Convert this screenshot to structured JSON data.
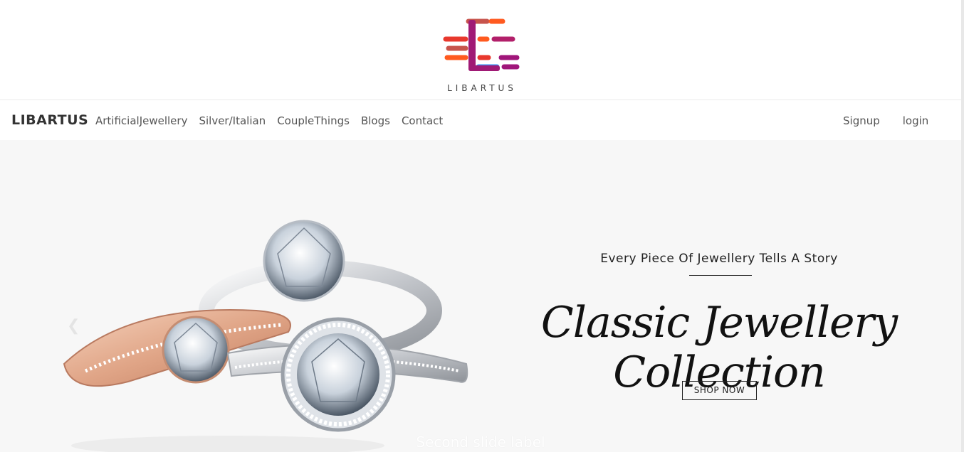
{
  "logo": {
    "text": "LIBARTUS",
    "icon": "libartus-logo-mark"
  },
  "nav": {
    "brand": "LIBARTUS",
    "links": [
      "ArtificialJewellery",
      "Silver/Italian",
      "CoupleThings",
      "Blogs",
      "Contact"
    ],
    "right": [
      "Signup",
      "login"
    ]
  },
  "hero": {
    "tagline": "Every Piece Of Jewellery Tells A Story",
    "headline": "Classic Jewellery Collection",
    "cta": "SHOP NOW",
    "caption": "Second slide label",
    "prev_icon": "chevron-left-icon",
    "image": "rings-product-image"
  },
  "colors": {
    "logo_gradient": [
      "#3b8cf0",
      "#ff5a1f",
      "#a0167a"
    ],
    "hero_bg": "#f7f7f7"
  }
}
